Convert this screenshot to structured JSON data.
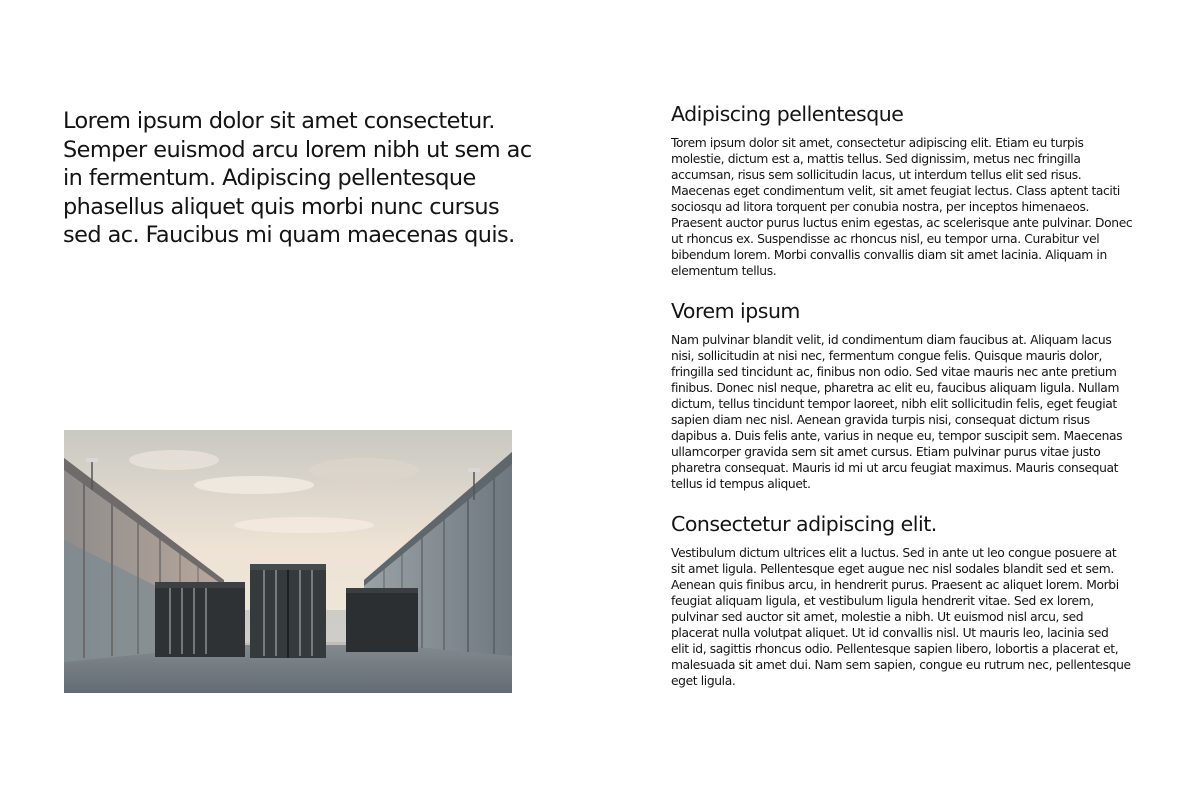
{
  "intro": {
    "text": "Lorem ipsum dolor sit amet consectetur. Semper euismod arcu lorem nibh ut sem ac in fermentum. Adipiscing pellentesque phasellus aliquet quis morbi nunc cursus sed ac. Faucibus mi quam maecenas quis."
  },
  "image": {
    "subject": "shipping-containers-between-warehouses-photo"
  },
  "sections": [
    {
      "heading": "Adipiscing pellentesque",
      "body": "Torem ipsum dolor sit amet, consectetur adipiscing elit. Etiam eu turpis\nmolestie, dictum est a, mattis tellus. Sed dignissim, metus nec fringilla\naccumsan, risus sem sollicitudin lacus, ut interdum tellus elit sed risus.\nMaecenas eget condimentum velit, sit amet feugiat lectus. Class aptent taciti\nsociosqu ad litora torquent per conubia nostra, per inceptos himenaeos.\nPraesent auctor purus luctus enim egestas, ac scelerisque ante pulvinar. Donec\nut rhoncus ex. Suspendisse ac rhoncus nisl, eu tempor urna. Curabitur vel\nbibendum lorem. Morbi convallis convallis diam sit amet lacinia. Aliquam in\nelementum tellus."
    },
    {
      "heading": "Vorem ipsum",
      "body": "Nam pulvinar blandit velit, id condimentum diam faucibus at. Aliquam lacus\nnisi, sollicitudin at nisi nec, fermentum congue felis. Quisque mauris dolor,\nfringilla sed tincidunt ac, finibus non odio. Sed vitae mauris nec ante pretium\nfinibus. Donec nisl neque, pharetra ac elit eu, faucibus aliquam ligula. Nullam\ndictum, tellus tincidunt tempor laoreet, nibh elit sollicitudin felis, eget feugiat\nsapien diam nec nisl. Aenean gravida turpis nisi, consequat dictum risus\ndapibus a. Duis felis ante, varius in neque eu, tempor suscipit sem. Maecenas\nullamcorper gravida sem sit amet cursus. Etiam pulvinar purus vitae justo\npharetra consequat. Mauris id mi ut arcu feugiat maximus. Mauris consequat\ntellus id tempus aliquet."
    },
    {
      "heading": "Consectetur adipiscing elit.",
      "body": "Vestibulum dictum ultrices elit a luctus. Sed in ante ut leo congue posuere at\nsit amet ligula. Pellentesque eget augue nec nisl sodales blandit sed et sem.\nAenean quis finibus arcu, in hendrerit purus. Praesent ac aliquet lorem. Morbi\nfeugiat aliquam ligula, et vestibulum ligula hendrerit vitae. Sed ex lorem,\npulvinar sed auctor sit amet, molestie a nibh. Ut euismod nisl arcu, sed\nplacerat nulla volutpat aliquet. Ut id convallis nisl. Ut mauris leo, lacinia sed\nelit id, sagittis rhoncus odio. Pellentesque sapien libero, lobortis a placerat et,\nmalesuada sit amet dui. Nam sem sapien, congue eu rutrum nec, pellentesque\neget ligula."
    }
  ]
}
